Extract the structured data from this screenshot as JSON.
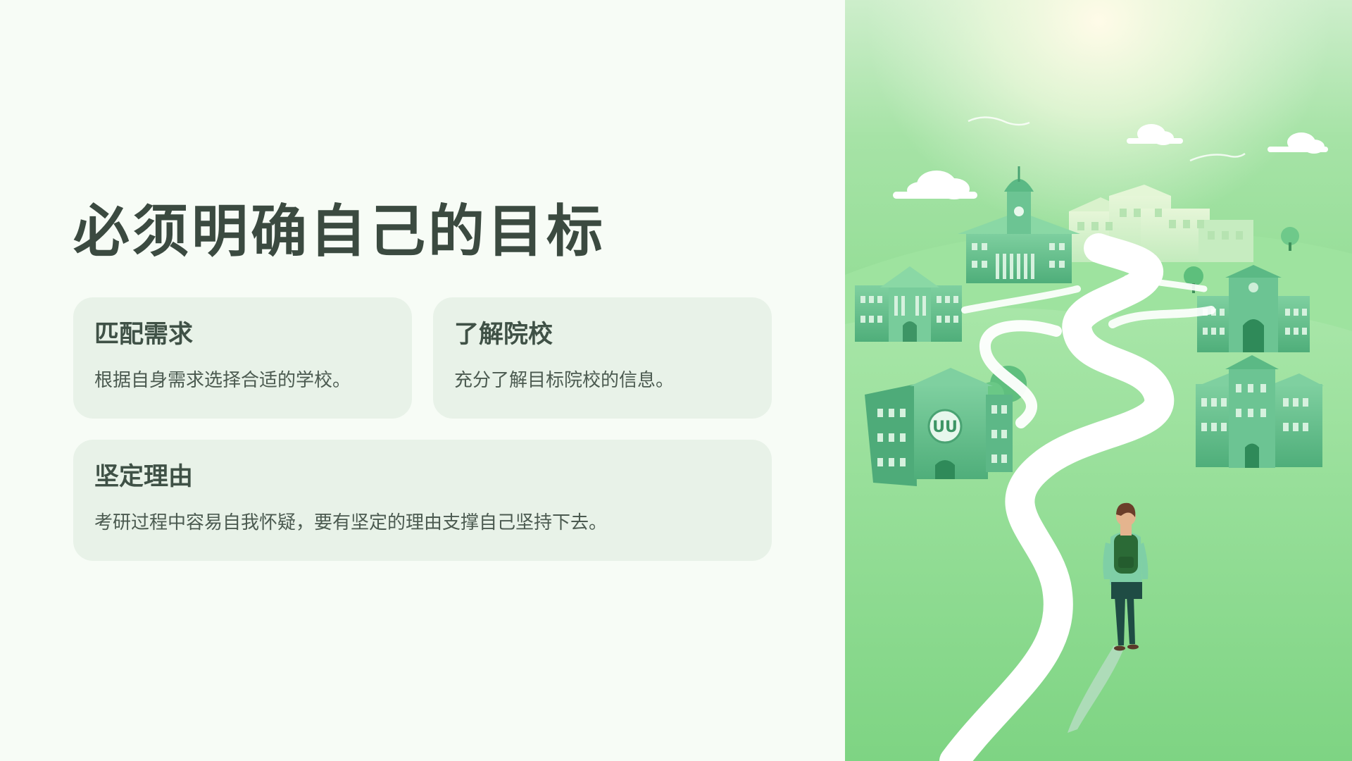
{
  "slide": {
    "title": "必须明确自己的目标"
  },
  "cards": [
    {
      "title": "匹配需求",
      "description": "根据自身需求选择合适的学校。"
    },
    {
      "title": "了解院校",
      "description": "充分了解目标院校的信息。"
    },
    {
      "title": "坚定理由",
      "description": "考研过程中容易自我怀疑，要有坚定的理由支撑自己坚持下去。"
    }
  ],
  "illustration": {
    "emblem_text": "UU"
  },
  "colors": {
    "background": "#f7fcf6",
    "card_background": "#e8f2e8",
    "title_text": "#3b4a40",
    "illustration_green": "#86d88a",
    "building_green": "#5cbf84",
    "path_white": "#ffffff"
  }
}
